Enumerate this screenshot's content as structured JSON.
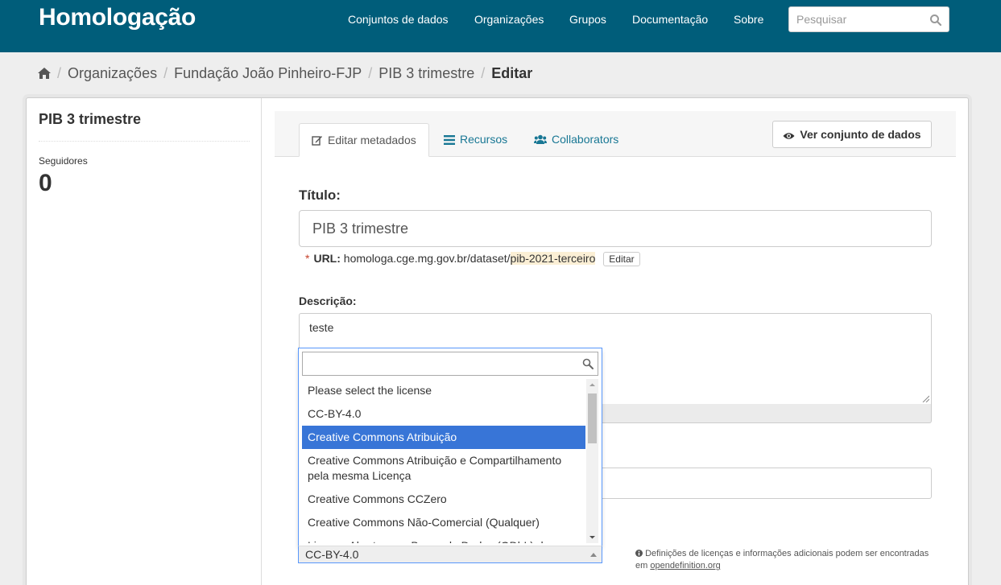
{
  "header": {
    "brand": "Homologação",
    "nav": [
      "Conjuntos de dados",
      "Organizações",
      "Grupos",
      "Documentação",
      "Sobre"
    ],
    "search_placeholder": "Pesquisar"
  },
  "breadcrumb": {
    "items": [
      "Organizações",
      "Fundação João Pinheiro-FJP",
      "PIB 3 trimestre"
    ],
    "active": "Editar"
  },
  "aside": {
    "title": "PIB 3 trimestre",
    "followers_label": "Seguidores",
    "followers_count": "0"
  },
  "tabs": [
    "Editar metadados",
    "Recursos",
    "Collaborators"
  ],
  "view_button": "Ver conjunto de dados",
  "form": {
    "title_label": "Título:",
    "title_value": "PIB 3 trimestre",
    "url_label": "URL:",
    "url_prefix": "homologa.cge.mg.gov.br/dataset/",
    "url_slug": "pib-2021-terceiro",
    "url_edit": "Editar",
    "description_label": "Descrição:",
    "description_value": "teste",
    "license_help": "Definições de licenças e informações adicionais podem ser encontradas em",
    "license_link": "opendefinition.org"
  },
  "license_dropdown": {
    "options": [
      "Please select the license",
      "CC-BY-4.0",
      "Creative Commons Atribuição",
      "Creative Commons Atribuição e Compartilhamento pela mesma Licença",
      "Creative Commons CCZero",
      "Creative Commons Não-Comercial (Qualquer)",
      "Licenca Aberta para Bases de Dados (ODbL) do"
    ],
    "highlighted": "Creative Commons Atribuição",
    "current": "CC-BY-4.0"
  },
  "colors": {
    "header_bg": "#005d7a",
    "link": "#187794",
    "select_highlight": "#3875d7"
  }
}
